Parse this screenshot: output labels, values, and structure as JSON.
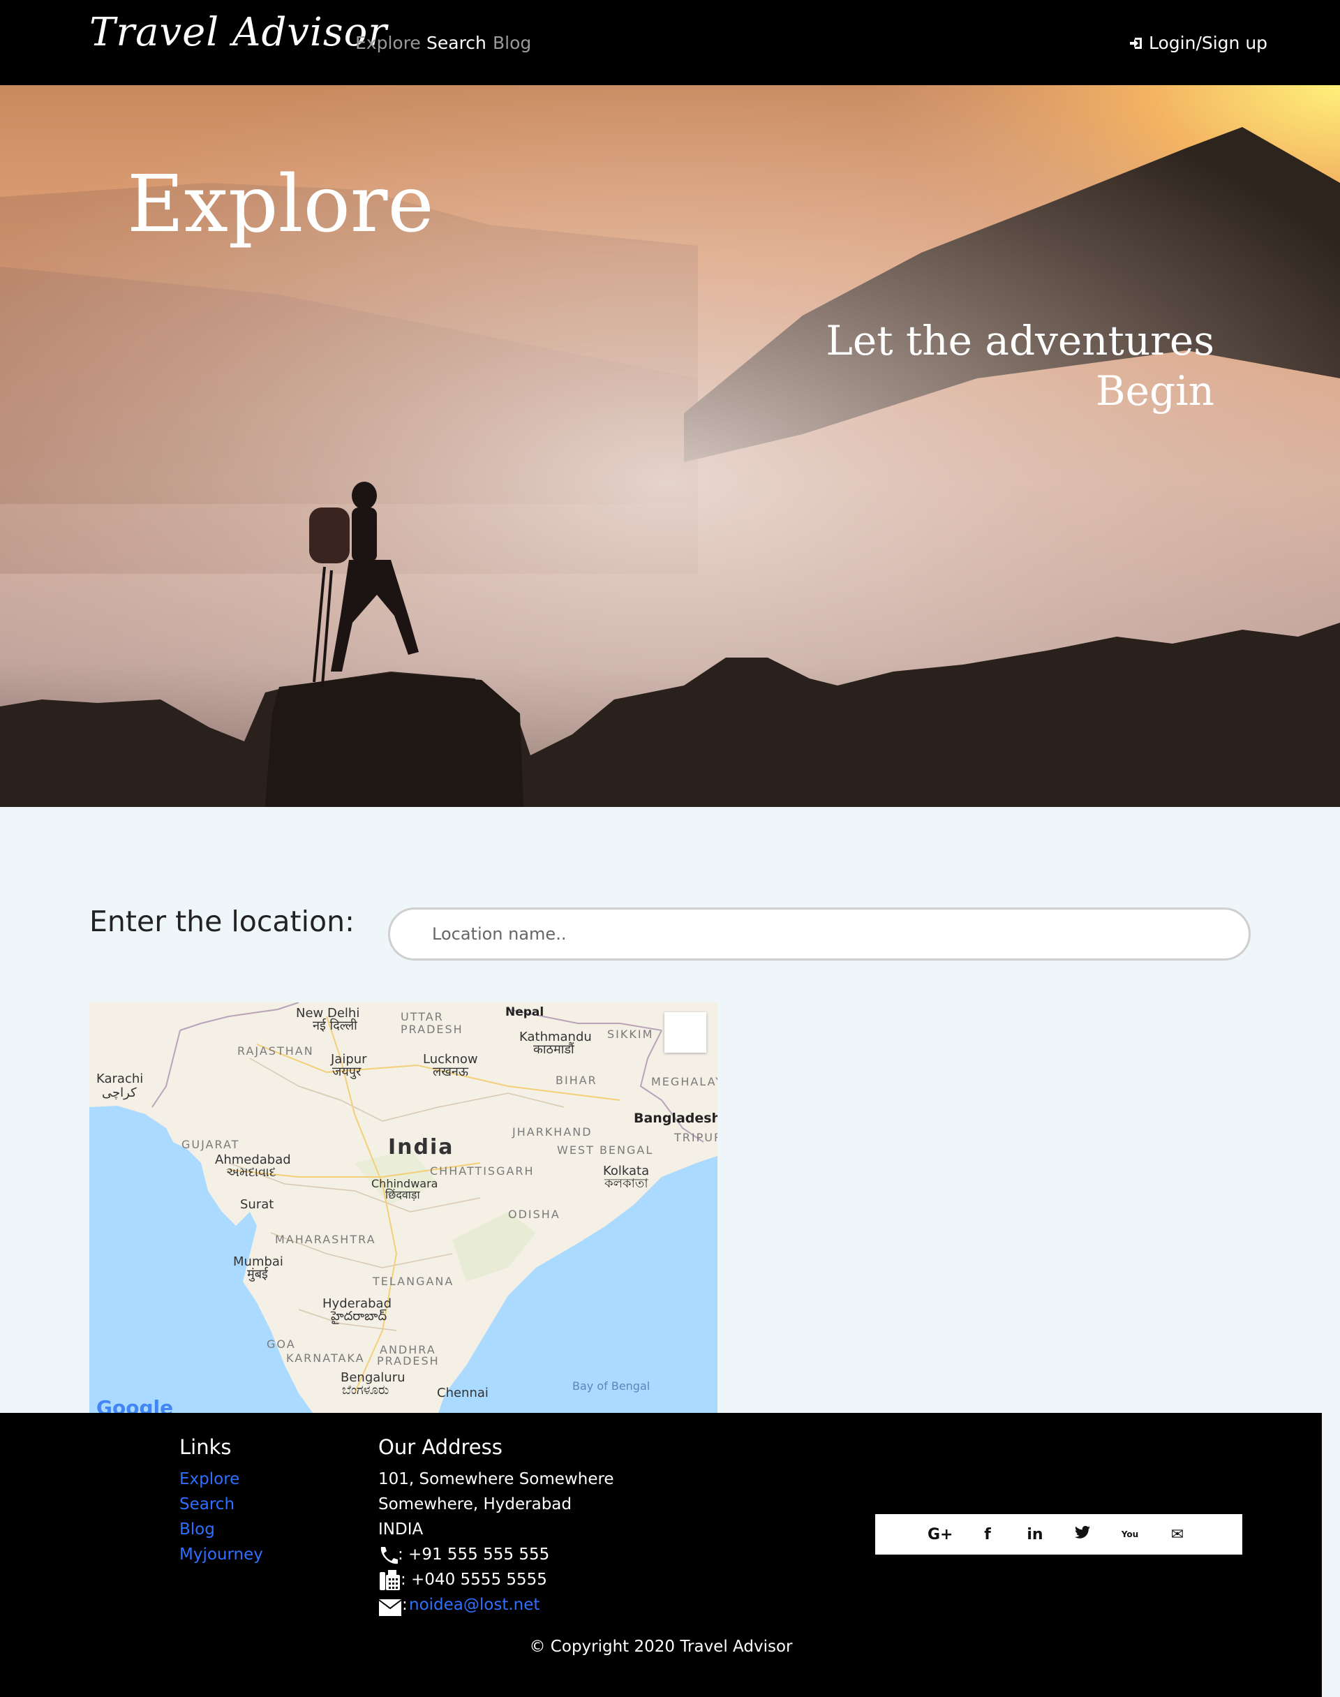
{
  "nav": {
    "brand": "Travel Advisor",
    "links": [
      {
        "label": "Explore"
      },
      {
        "label": "Search"
      },
      {
        "label": "Blog"
      }
    ],
    "login": "Login/Sign up"
  },
  "hero": {
    "title": "Explore",
    "subtitle_line1": "Let the adventures",
    "subtitle_line2": "Begin"
  },
  "search": {
    "label": "Enter the location:",
    "placeholder": "Location name.."
  },
  "map": {
    "labels": {
      "new_delhi": "New Delhi",
      "new_delhi_hi": "नई दिल्ली",
      "uttar_pradesh": "UTTAR PRADESH",
      "nepal": "Nepal",
      "kathmandu": "Kathmandu",
      "kathmandu_ne": "काठमाडौं",
      "sikkim": "SIKKIM",
      "rajasthan": "RAJASTHAN",
      "jaipur": "Jaipur",
      "jaipur_hi": "जयपुर",
      "lucknow": "Lucknow",
      "lucknow_hi": "लखनऊ",
      "karachi": "Karachi",
      "karachi_ur": "کراچی",
      "bihar": "BIHAR",
      "meghalaya": "MEGHALAY",
      "bangladesh": "Bangladesh",
      "tripura": "TRIPUR",
      "jharkhand": "JHARKHAND",
      "gujarat": "GUJARAT",
      "india": "India",
      "west_bengal": "WEST BENGAL",
      "ahmedabad": "Ahmedabad",
      "ahmedabad_gu": "અમદાવાદ",
      "chhattisgarh": "CHHATTISGARH",
      "kolkata": "Kolkata",
      "kolkata_bn": "কলকাতা",
      "chhindwara": "Chhindwara",
      "chhindwara_hi": "छिंदवाड़ा",
      "surat": "Surat",
      "odisha": "ODISHA",
      "maharashtra": "MAHARASHTRA",
      "mumbai": "Mumbai",
      "mumbai_hi": "मुंबई",
      "telangana": "TELANGANA",
      "hyderabad": "Hyderabad",
      "hyderabad_te": "హైదరాబాద్",
      "goa": "GOA",
      "andhra": "ANDHRA",
      "pradesh": "PRADESH",
      "karnataka": "KARNATAKA",
      "bengaluru": "Bengaluru",
      "bengaluru_kn": "ಬೆಂಗಳೂರು",
      "chennai": "Chennai",
      "bay_of_bengal": "Bay of Bengal"
    },
    "google": "Google",
    "colors": {
      "land": "#f4f0e6",
      "water": "#aadaff"
    }
  },
  "footer": {
    "links_heading": "Links",
    "links": [
      "Explore",
      "Search",
      "Blog",
      "Myjourney"
    ],
    "address_heading": "Our Address",
    "address_line1": "101, Somewhere Somewhere",
    "address_line2": "Somewhere, Hyderabad",
    "address_line3": "INDIA",
    "phone": ": +91 555 555 555",
    "fax": ": +040 5555 5555",
    "email_prefix": ":",
    "email": "noidea@lost.net",
    "social": {
      "google_plus": "G+",
      "facebook": "f",
      "linkedin": "in",
      "twitter": "t",
      "youtube": "You",
      "mail": "✉"
    },
    "copyright": "© Copyright 2020 Travel Advisor"
  }
}
